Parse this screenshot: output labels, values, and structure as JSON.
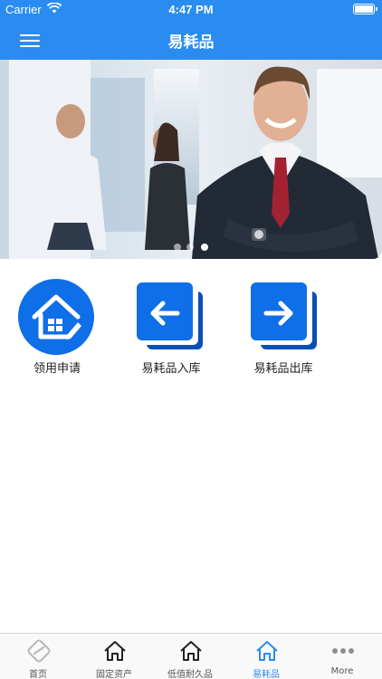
{
  "status_bar": {
    "carrier": "Carrier",
    "time": "4:47 PM"
  },
  "nav": {
    "title": "易耗品"
  },
  "banner": {
    "slides_total": 3,
    "active_slide": 3
  },
  "actions": [
    {
      "label": "领用申请",
      "icon": "house-edit-icon"
    },
    {
      "label": "易耗品入库",
      "icon": "arrow-left-icon"
    },
    {
      "label": "易耗品出库",
      "icon": "arrow-right-icon"
    }
  ],
  "tabs": [
    {
      "label": "首页",
      "icon": "home-logo-icon",
      "active": false
    },
    {
      "label": "固定资产",
      "icon": "house-icon",
      "active": false
    },
    {
      "label": "低值耐久品",
      "icon": "house-icon",
      "active": false
    },
    {
      "label": "易耗品",
      "icon": "house-icon",
      "active": true
    },
    {
      "label": "More",
      "icon": "more-dots-icon",
      "active": false
    }
  ],
  "colors": {
    "primary": "#2a8cf0",
    "icon_blue": "#0e6fe8",
    "tab_inactive": "#555555"
  }
}
